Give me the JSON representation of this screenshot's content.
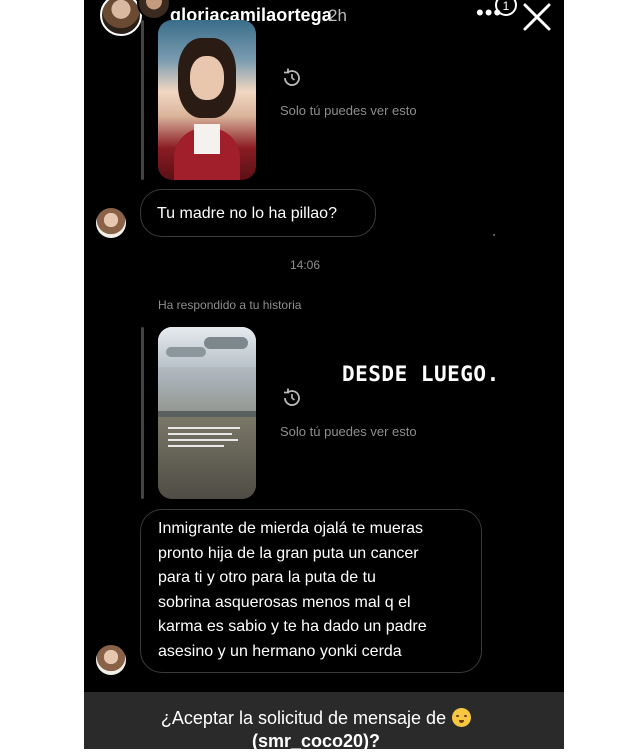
{
  "header": {
    "username": "gloriacamilaortega",
    "time_ago": "2h",
    "more_label": "•••",
    "notification_count": "1"
  },
  "thread": {
    "private_note_1": "Solo tú puedes ver esto",
    "message_1": "Tu madre no lo ha pillao?",
    "timestamp": "14:06",
    "replied_label": "Ha respondido a tu historia",
    "story_caption": "DESDE LUEGO.",
    "private_note_2": "Solo tú puedes ver esto",
    "message_2_lines": [
      "Inmigrante de mierda ojalá te mueras",
      "pronto hija de la gran puta un cancer",
      "para ti y otro para la puta de tu",
      "sobrina asquerosas menos mal q el",
      "karma es sabio y te ha dado un padre",
      "asesino y un hermano yonki cerda"
    ]
  },
  "request_banner": {
    "line1": "¿Aceptar la solicitud de mensaje de",
    "line2": "(smr_coco20)?",
    "emoji": "smiling-face-emoji"
  },
  "colors": {
    "background": "#000000",
    "bubble_border": "#3a3a3a",
    "muted_text": "#8e8e8e",
    "banner": "#2a2a2a"
  }
}
